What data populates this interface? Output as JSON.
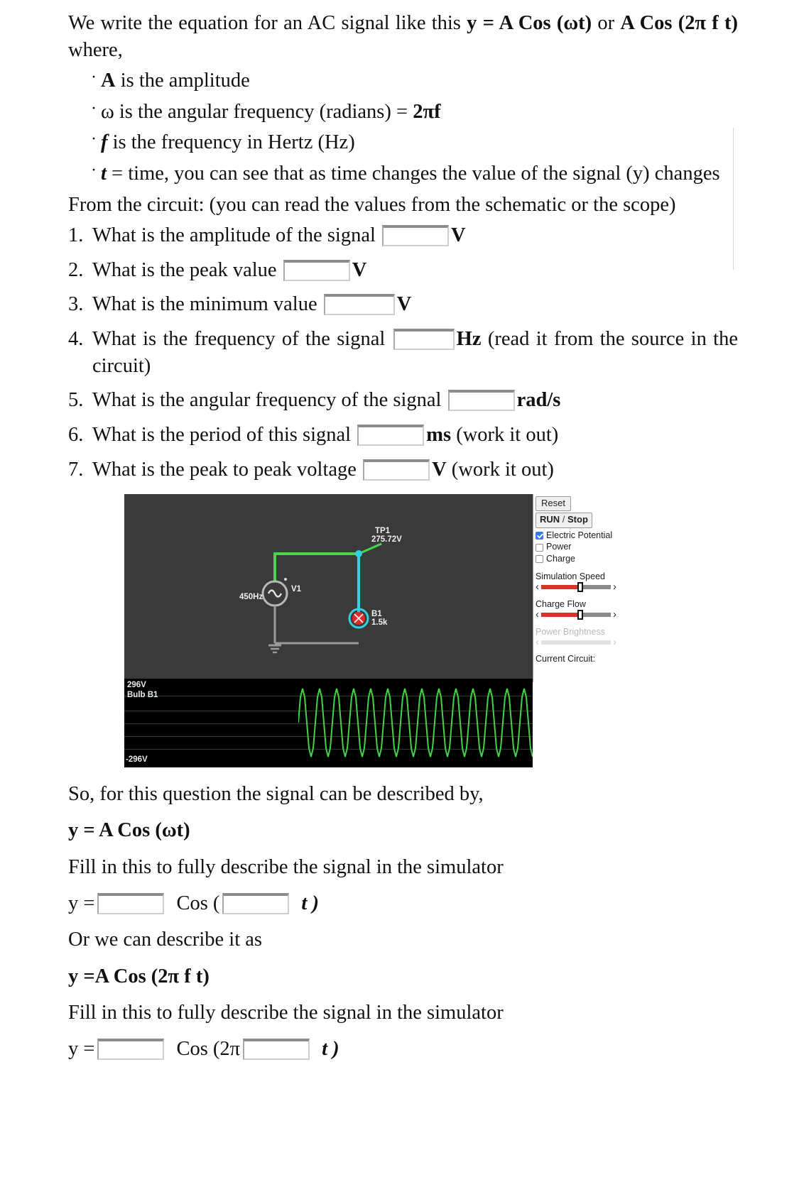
{
  "intro": {
    "line1_a": "We write the equation for an AC signal like this ",
    "line1_b": "y = A Cos (ωt)",
    "line1_c": " or ",
    "line1_d": "A Cos (2π f t)",
    "line1_e": " where,"
  },
  "bullets": [
    {
      "bold_lead": "A",
      "rest": " is the amplitude"
    },
    {
      "bold_lead": "ω",
      "rest": " is the angular frequency (radians) = ",
      "bold_tail": "2πf"
    },
    {
      "bold_lead": "f",
      "rest": " is the frequency in Hertz (Hz)"
    },
    {
      "bold_lead": "t",
      "rest": " = time, you can see that as time changes the value of the signal (y) changes"
    }
  ],
  "from_circuit": "From the circuit: (you can read the values from the schematic or the scope)",
  "questions": [
    {
      "num": "1.",
      "text": "What is the amplitude of the signal",
      "unit": "V",
      "tail": ""
    },
    {
      "num": "2.",
      "text": "What is the peak value",
      "unit": "V",
      "tail": ""
    },
    {
      "num": "3.",
      "text": "What is the minimum value",
      "unit": "V",
      "tail": ""
    },
    {
      "num": "4.",
      "text": "What is the frequency of the signal",
      "unit": "Hz",
      "tail": " (read it from the source in the circuit)"
    },
    {
      "num": "5.",
      "text": "What is the angular frequency of the signal",
      "unit": "rad/s",
      "tail": ""
    },
    {
      "num": "6.",
      "text": "What is the period of this signal",
      "unit": "ms",
      "tail": " (work it out)"
    },
    {
      "num": "7.",
      "text": "What is the peak to peak voltage",
      "unit": "V",
      "tail": " (work it out)"
    }
  ],
  "simulator": {
    "controls": {
      "reset_label": "Reset",
      "run_stop_bold": "RUN",
      "run_stop_slash": " / ",
      "run_stop_rest": "Stop",
      "checkboxes": [
        {
          "label": "Electric Potential",
          "checked": true
        },
        {
          "label": "Power",
          "checked": false
        },
        {
          "label": "Charge",
          "checked": false
        }
      ],
      "sliders": [
        {
          "label": "Simulation Speed",
          "enabled": true,
          "fill_percent": 55
        },
        {
          "label": "Charge Flow",
          "enabled": true,
          "fill_percent": 55
        },
        {
          "label": "Power Brightness",
          "enabled": false,
          "fill_percent": 0
        }
      ],
      "current_circuit_label": "Current Circuit:",
      "left_arrow_glyph": "‹",
      "right_arrow_glyph": "›"
    },
    "circuit": {
      "testpoint_name": "TP1",
      "testpoint_value": "275.72V",
      "source_name": "V1",
      "source_freq": "450Hz",
      "bulb_name": "B1",
      "bulb_value": "1.5k",
      "wire_green": "#49d44a",
      "wire_cyan": "#35cfe0",
      "bulb_red": "#e02b2b",
      "canvas_bg": "#3a3a3a"
    },
    "scope": {
      "top_label": "296V",
      "channel_label": "Bulb B1",
      "bottom_label": "-296V",
      "trace_color": "#46d246",
      "background": "#000000"
    }
  },
  "outro": {
    "line1": "So, for this question the signal can be described by,",
    "eq1": "y = A Cos (ωt)",
    "line2": "Fill in this to fully describe the signal in the simulator",
    "fill1_lead": "y =",
    "fill1_mid": "Cos (",
    "fill1_tail": "t )",
    "line3": "Or we can describe it as",
    "eq2": "y =A Cos (2π f t)",
    "line4": "Fill in this to fully describe the signal in the simulator",
    "fill2_lead": "y =",
    "fill2_mid": "Cos (2π",
    "fill2_tail": "t )"
  }
}
